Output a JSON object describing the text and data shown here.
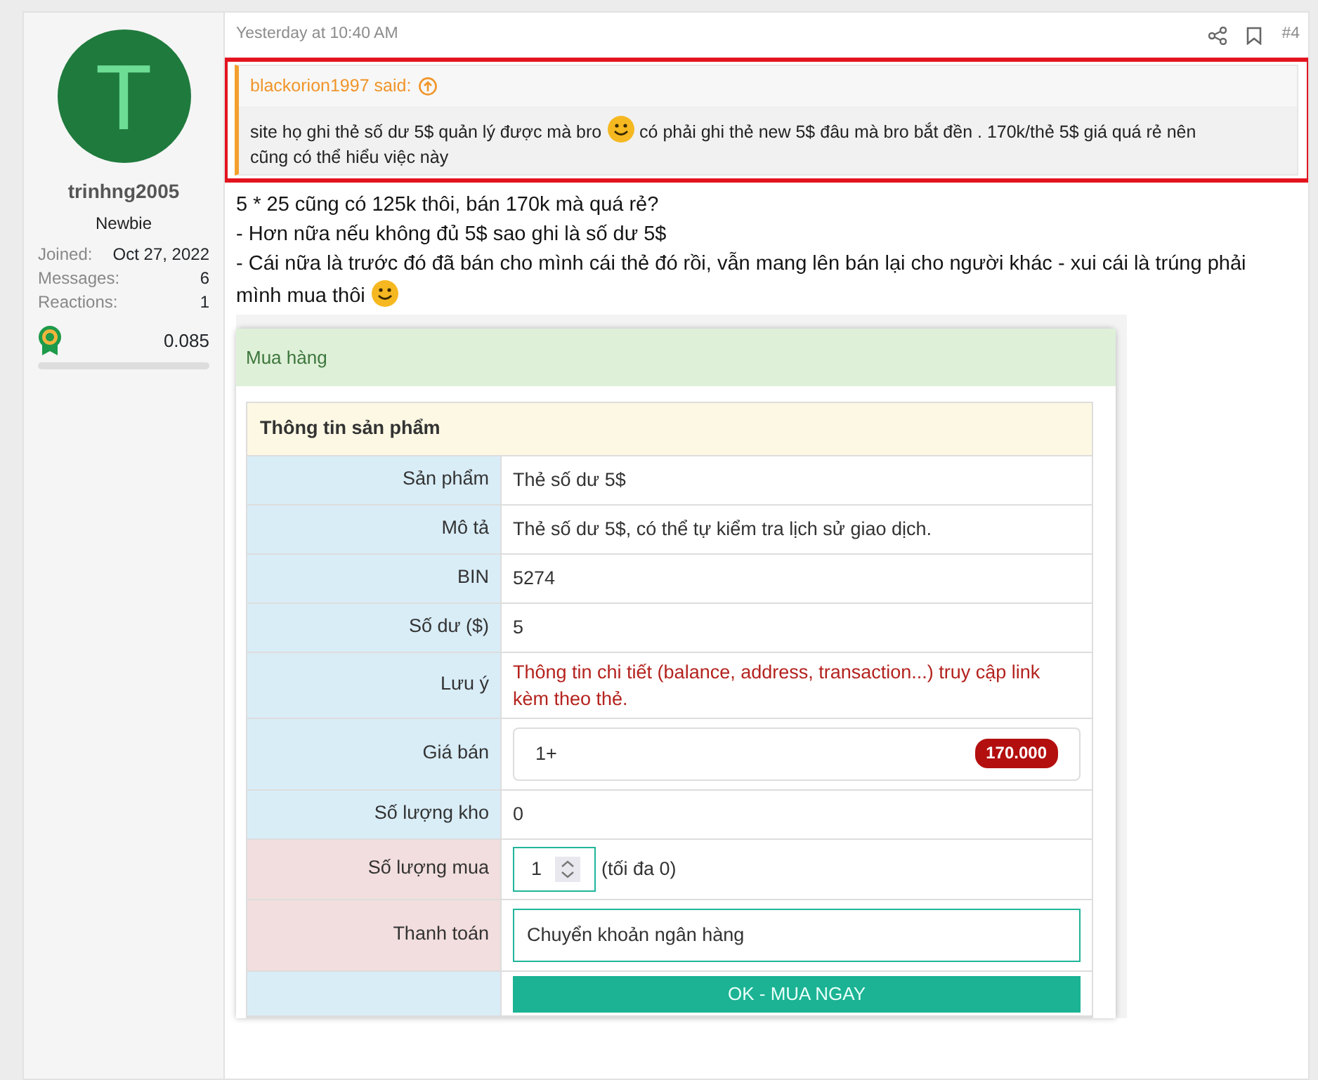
{
  "sidebar": {
    "avatar_letter": "T",
    "username": "trinhng2005",
    "user_title": "Newbie",
    "stats": [
      {
        "label": "Joined:",
        "value": "Oct 27, 2022"
      },
      {
        "label": "Messages:",
        "value": "6"
      },
      {
        "label": "Reactions:",
        "value": "1"
      }
    ],
    "reward": {
      "value": "0.085",
      "level": 0
    }
  },
  "post": {
    "timestamp": "Yesterday at 10:40 AM",
    "number": "#4",
    "quote": {
      "author": "blackorion1997 said:",
      "lines": [
        [
          {
            "kind": "text",
            "text": "site họ ghi thẻ số dư 5$ quản lý được mà bro"
          },
          {
            "kind": "smiley"
          },
          {
            "kind": "text",
            "text": "có phải ghi thẻ new 5$ đâu mà bro bắt đền . 170k/thẻ 5$ giá quá rẻ nên"
          }
        ],
        [
          {
            "kind": "text",
            "text": "cũng có thể hiểu việc này"
          }
        ]
      ]
    },
    "lines": [
      [
        {
          "kind": "text",
          "text": "5 * 25 cũng có 125k thôi, bán 170k mà quá rẻ?"
        }
      ],
      [
        {
          "kind": "text",
          "text": "- Hơn nữa nếu không đủ 5$ sao ghi là số dư 5$"
        }
      ],
      [
        {
          "kind": "text",
          "text": "- Cái nữa là trước đó đã bán cho mình cái thẻ đó rồi, vẫn mang lên bán lại cho người khác - xui cái là trúng phải"
        }
      ],
      [
        {
          "kind": "text",
          "text": "mình mua thôi"
        },
        {
          "kind": "smiley"
        }
      ]
    ],
    "shop": {
      "header": "Mua hàng",
      "panel_title": "Thông tin sản phẩm",
      "rows": [
        {
          "label": "Sản phẩm",
          "color": "#d9edf7",
          "kind": "text",
          "value": "Thẻ số dư 5$"
        },
        {
          "label": "Mô tả",
          "color": "#d9edf7",
          "kind": "text",
          "value": "Thẻ số dư 5$, có thể tự kiểm tra lịch sử giao dịch."
        },
        {
          "label": "BIN",
          "color": "#d9edf7",
          "kind": "text",
          "value": "5274"
        },
        {
          "label": "Số dư ($)",
          "color": "#d9edf7",
          "kind": "text",
          "value": "5"
        },
        {
          "label": "Lưu ý",
          "color": "#d9edf7",
          "kind": "note",
          "value": "Thông tin chi tiết (balance, address, transaction...) truy cập link kèm theo thẻ."
        },
        {
          "label": "Giá bán",
          "color": "#d9edf7",
          "kind": "price",
          "value": "1+",
          "badge": "170.000"
        },
        {
          "label": "Số lượng kho",
          "color": "#d9edf7",
          "kind": "text",
          "value": "0"
        },
        {
          "label": "Số lượng mua",
          "color": "#f2dede",
          "kind": "quantity",
          "value": "1",
          "hint": "(tối đa 0)"
        },
        {
          "label": "Thanh toán",
          "color": "#f2dede",
          "kind": "select",
          "value": "Chuyển khoản ngân hàng"
        },
        {
          "color": "#d9edf7",
          "kind": "button",
          "value": "OK - MUA NGAY"
        }
      ]
    }
  }
}
